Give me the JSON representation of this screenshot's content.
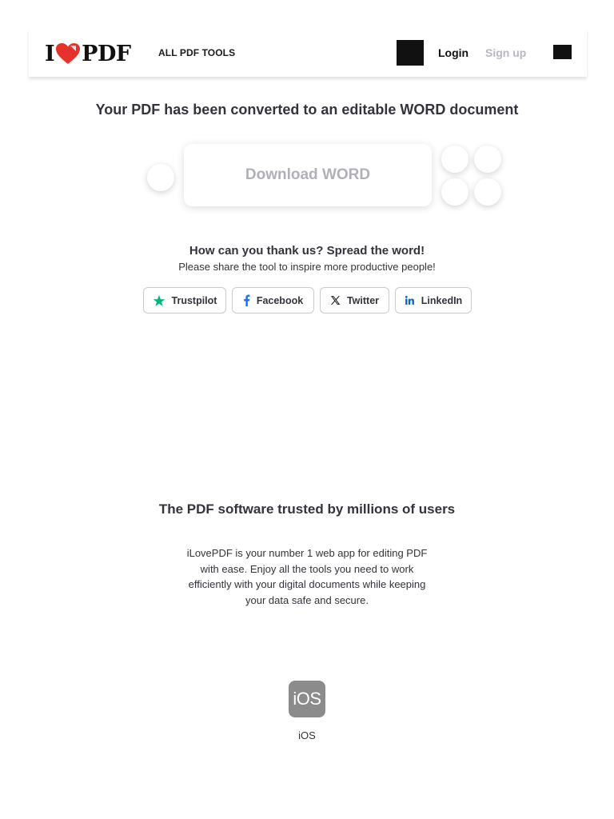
{
  "header": {
    "logo_left": "I",
    "logo_right": "PDF",
    "nav_tools": "ALL PDF TOOLS",
    "login": "Login",
    "signup": "Sign up"
  },
  "result": {
    "title": "Your PDF has been converted to an editable WORD document",
    "download_label": "Download WORD"
  },
  "share": {
    "title": "How can you thank us? Spread the word!",
    "subtitle": "Please share the tool to inspire more productive people!",
    "buttons": [
      {
        "label": "Trustpilot",
        "icon": "star-icon"
      },
      {
        "label": "Facebook",
        "icon": "facebook-icon"
      },
      {
        "label": "Twitter",
        "icon": "x-icon"
      },
      {
        "label": "LinkedIn",
        "icon": "linkedin-icon"
      }
    ]
  },
  "trusted": {
    "title": "The PDF software trusted by millions of users",
    "description": "iLovePDF is your number 1 web app for editing PDF with ease. Enjoy all the tools you need to work efficiently with your digital documents while keeping your data safe and secure."
  },
  "apps": {
    "ios_badge": "iOS",
    "ios_label": "iOS"
  },
  "colors": {
    "brand_red": "#e5322d",
    "trustpilot_green": "#00b67a",
    "facebook_blue": "#1877f2",
    "linkedin_blue": "#0a66c2",
    "text_dark": "#33333b",
    "muted_gray": "#b8b8c0"
  }
}
